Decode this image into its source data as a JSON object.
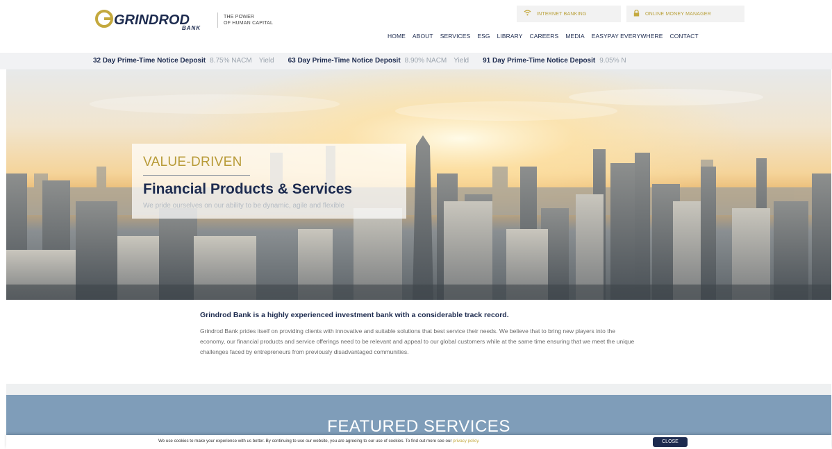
{
  "header": {
    "logo_text": "GRINDROD",
    "logo_sub": "BANK",
    "tagline_line1": "THE POWER",
    "tagline_line2": "OF HUMAN CAPITAL",
    "internet_banking": "INTERNET BANKING",
    "online_money_manager": "ONLINE MONEY MANAGER",
    "nav": [
      "HOME",
      "ABOUT",
      "SERVICES",
      "ESG",
      "LIBRARY",
      "CAREERS",
      "MEDIA",
      "EASYPAY EVERYWHERE",
      "CONTACT"
    ]
  },
  "ticker": [
    {
      "name": "32 Day Prime-Time Notice Deposit",
      "rate": "8.75% NACM",
      "yield": "Yield"
    },
    {
      "name": "63 Day Prime-Time Notice Deposit",
      "rate": "8.90% NACM",
      "yield": "Yield"
    },
    {
      "name": "91 Day Prime-Time Notice Deposit",
      "rate": "9.05% N",
      "yield": ""
    }
  ],
  "hero": {
    "eyebrow": "VALUE-DRIVEN",
    "title": "Financial Products & Services",
    "subtitle": "We pride ourselves on our ability to be dynamic, agile and flexible"
  },
  "intro": {
    "title": "Grindrod Bank is a highly experienced investment bank with a considerable track record.",
    "body": "Grindrod Bank prides itself on providing clients with innovative and suitable solutions that best service their needs. We believe that to bring new players into the economy, our financial products and service offerings need to be relevant and appeal to our global customers while at the same time ensuring that we meet the unique challenges faced by entrepreneurs from previously disadvantaged communities."
  },
  "featured": {
    "title": "FEATURED SERVICES"
  },
  "cookie": {
    "text": "We use cookies to make your experience with us better. By continuing to use our website, you are agreeing to our use of cookies. To find out more see our",
    "link": "privacy policy.",
    "close": "CLOSE"
  },
  "colors": {
    "navy": "#1d2b4f",
    "gold": "#b89b38",
    "featured_bg": "#7f9db9"
  },
  "icons": {
    "internet_banking": "wifi-icon",
    "online_money_manager": "lock-icon"
  }
}
